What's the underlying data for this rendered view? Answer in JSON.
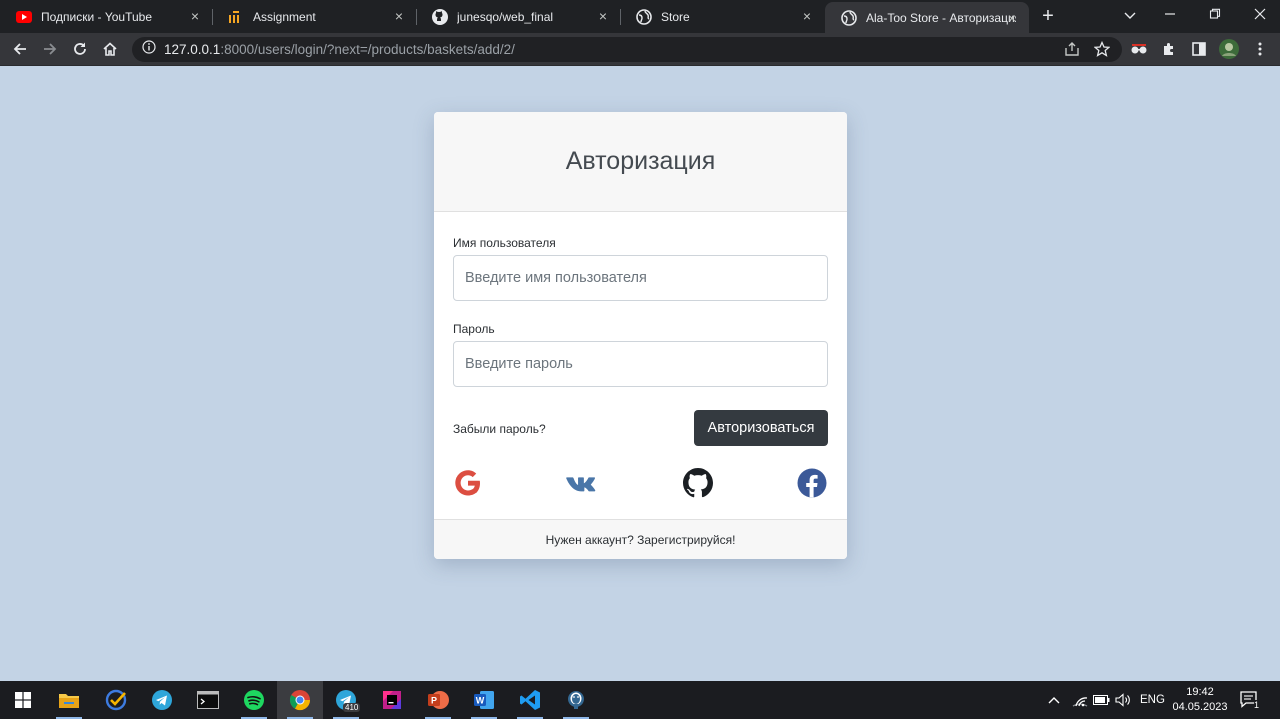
{
  "browser": {
    "tabs": [
      {
        "title": "Подписки - YouTube",
        "icon": "youtube-icon",
        "active": false
      },
      {
        "title": "Assignment",
        "icon": "instructure-icon",
        "active": false
      },
      {
        "title": "junesqo/web_final",
        "icon": "github-icon",
        "active": false
      },
      {
        "title": "Store",
        "icon": "globe-icon",
        "active": false
      },
      {
        "title": "Ala-Too Store - Авторизация",
        "icon": "globe-icon",
        "active": true
      }
    ],
    "address": {
      "host": "127.0.0.1",
      "rest": ":8000/users/login/?next=/products/baskets/add/2/"
    }
  },
  "login": {
    "title": "Авторизация",
    "username_label": "Имя пользователя",
    "username_placeholder": "Введите имя пользователя",
    "password_label": "Пароль",
    "password_placeholder": "Введите пароль",
    "forgot_label": "Забыли пароль?",
    "submit_label": "Авторизоваться",
    "social": [
      "google-icon",
      "vk-icon",
      "github-icon",
      "facebook-icon"
    ],
    "footer_label": "Нужен аккаунт? Зарегистрируйся!"
  },
  "taskbar": {
    "language": "ENG",
    "time": "19:42",
    "date": "04.05.2023",
    "telegram_badge": "410",
    "notifications": "1"
  },
  "colors": {
    "page_bg": "#c3d3e5",
    "button_bg": "#343a40",
    "google": "#ea4335",
    "vk": "#4a76a8",
    "facebook": "#3b5998"
  }
}
